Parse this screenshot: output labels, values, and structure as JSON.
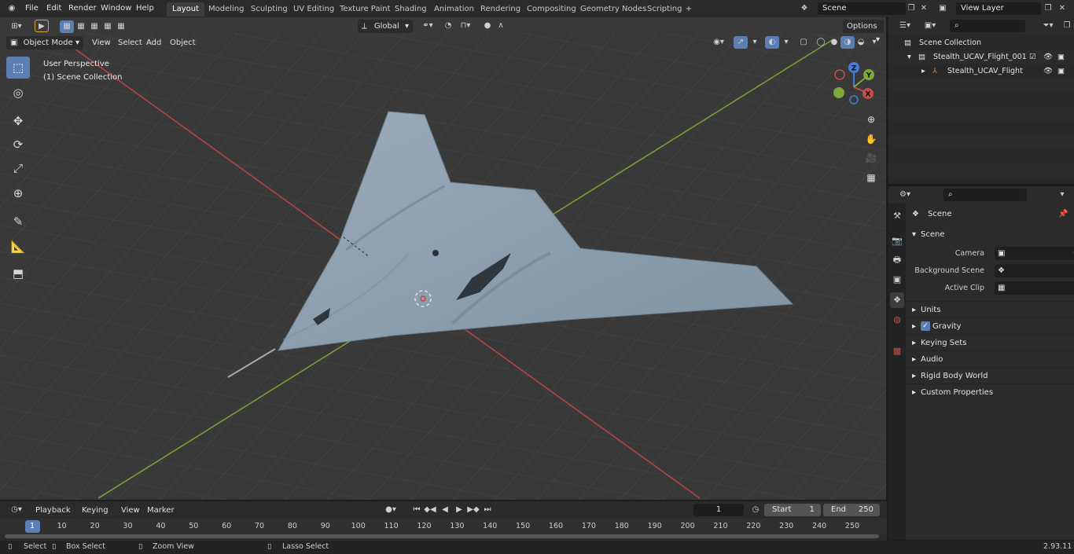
{
  "menu": {
    "file": "File",
    "edit": "Edit",
    "render": "Render",
    "window": "Window",
    "help": "Help"
  },
  "workspace_tabs": [
    "Layout",
    "Modeling",
    "Sculpting",
    "UV Editing",
    "Texture Paint",
    "Shading",
    "Animation",
    "Rendering",
    "Compositing",
    "Geometry Nodes",
    "Scripting"
  ],
  "active_tab": "Layout",
  "scene_field": "Scene",
  "view_layer_field": "View Layer",
  "viewport": {
    "mode": "Object Mode",
    "menus": [
      "View",
      "Select",
      "Add",
      "Object"
    ],
    "transform_orientation": "Global",
    "options": "Options",
    "overlay_line1": "User Perspective",
    "overlay_line2": "(1) Scene Collection",
    "gizmo": {
      "z": "Z",
      "y": "Y",
      "x": "X"
    }
  },
  "outliner": {
    "root": "Scene Collection",
    "collection": "Stealth_UCAV_Flight_001",
    "object": "Stealth_UCAV_Flight"
  },
  "properties": {
    "header": "Scene",
    "panel": "Scene",
    "camera_label": "Camera",
    "background_scene_label": "Background Scene",
    "active_clip_label": "Active Clip",
    "sections": [
      "Units",
      "Gravity",
      "Keying Sets",
      "Audio",
      "Rigid Body World",
      "Custom Properties"
    ],
    "gravity_checked": true
  },
  "timeline": {
    "menus": [
      "Playback",
      "Keying",
      "View",
      "Marker"
    ],
    "current_frame": "1",
    "start_label": "Start",
    "start_value": "1",
    "end_label": "End",
    "end_value": "250",
    "ticks": [
      "1",
      "10",
      "20",
      "30",
      "40",
      "50",
      "60",
      "70",
      "80",
      "90",
      "100",
      "110",
      "120",
      "130",
      "140",
      "150",
      "160",
      "170",
      "180",
      "190",
      "200",
      "210",
      "220",
      "230",
      "240",
      "250"
    ]
  },
  "statusbar": {
    "select": "Select",
    "box_select": "Box Select",
    "zoom_view": "Zoom View",
    "lasso_select": "Lasso Select",
    "version": "2.93.11"
  },
  "colors": {
    "accent": "#5c7fb3",
    "x_axis": "#c94a4a",
    "y_axis": "#7ea83a",
    "z_axis": "#4a7ad4",
    "aircraft": "#8a9eae"
  }
}
